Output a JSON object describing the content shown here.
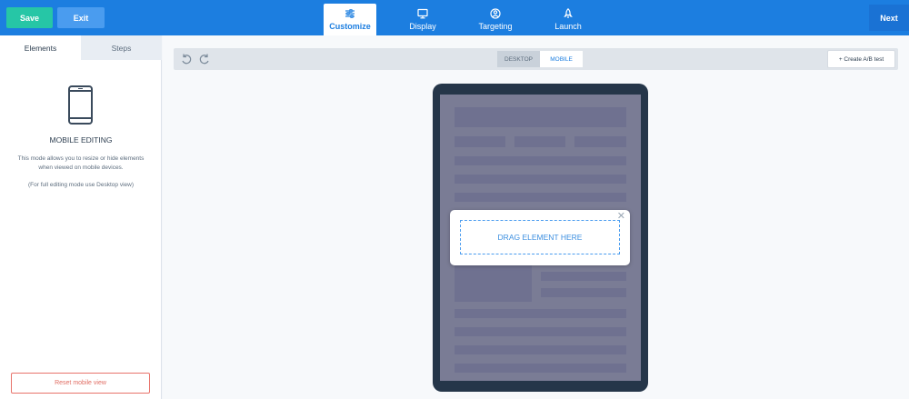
{
  "topbar": {
    "save_label": "Save",
    "exit_label": "Exit",
    "next_label": "Next",
    "tabs": [
      {
        "label": "Customize",
        "icon": "sliders-icon",
        "active": true
      },
      {
        "label": "Display",
        "icon": "monitor-icon",
        "active": false
      },
      {
        "label": "Targeting",
        "icon": "target-icon",
        "active": false
      },
      {
        "label": "Launch",
        "icon": "rocket-icon",
        "active": false
      }
    ]
  },
  "leftpanel": {
    "tabs": [
      {
        "label": "Elements",
        "active": true
      },
      {
        "label": "Steps",
        "active": false
      }
    ],
    "mobile_title": "MOBILE EDITING",
    "mobile_description": "This mode allows you to resize or hide elements when viewed on mobile devices.",
    "mobile_note": "(For full editing mode use Desktop view)",
    "reset_label": "Reset mobile view"
  },
  "toolbar": {
    "view_options": [
      "DESKTOP",
      "MOBILE"
    ],
    "selected_view": "MOBILE",
    "ab_test_label": "+ Create A/B test"
  },
  "popup": {
    "dropzone_text": "DRAG ELEMENT HERE",
    "close_glyph": "✕"
  },
  "colors": {
    "brand_blue": "#1c7ee0",
    "save_green": "#26c6a6",
    "reset_red": "#e06d63",
    "device_frame": "#253649"
  }
}
